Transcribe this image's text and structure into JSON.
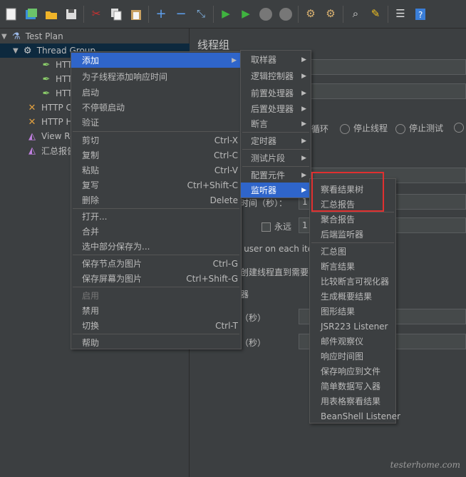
{
  "toolbar": {
    "icons": [
      "new-icon",
      "templates-icon",
      "open-icon",
      "save-icon",
      "cut-icon",
      "copy-icon",
      "paste-icon",
      "expand-icon",
      "collapse-icon",
      "toggle-icon",
      "start-icon",
      "start-no-pause-icon",
      "stop-icon",
      "shutdown-icon",
      "clear-icon",
      "clear-all-icon",
      "search-icon",
      "reset-search-icon",
      "function-helper-icon",
      "help-icon"
    ]
  },
  "tree": {
    "test_plan": "Test Plan",
    "thread_group": "Thread Group",
    "samplers": [
      "HTTP",
      "HTTP",
      "HTTP"
    ],
    "config1": "HTTP C",
    "config2": "HTTP H",
    "view_results": "View Re",
    "summary": "汇总报告"
  },
  "panel": {
    "title": "线程组",
    "loop_fragment": "续循环",
    "stop_thread": "停止线程",
    "stop_test": "停止测试",
    "ramp_fragment": "时间（秒）：",
    "ramp_value": "1",
    "forever": "永远",
    "loop_value": "1",
    "same_user": "e user on each iter",
    "delay_create": "创建线程直到需要",
    "scheduler": "器",
    "duration_unit": "（秒）",
    "delay_unit": "（秒）"
  },
  "context_menu": {
    "items": [
      {
        "label": "添加",
        "submenu": true
      },
      {
        "label": "为子线程添加响应时间"
      },
      {
        "label": "启动"
      },
      {
        "label": "不停顿启动"
      },
      {
        "label": "验证"
      },
      {
        "label": "剪切",
        "shortcut": "Ctrl-X"
      },
      {
        "label": "复制",
        "shortcut": "Ctrl-C"
      },
      {
        "label": "粘贴",
        "shortcut": "Ctrl-V"
      },
      {
        "label": "复写",
        "shortcut": "Ctrl+Shift-C"
      },
      {
        "label": "删除",
        "shortcut": "Delete"
      },
      {
        "label": "打开..."
      },
      {
        "label": "合并"
      },
      {
        "label": "选中部分保存为..."
      },
      {
        "label": "保存节点为图片",
        "shortcut": "Ctrl-G"
      },
      {
        "label": "保存屏幕为图片",
        "shortcut": "Ctrl+Shift-G"
      },
      {
        "label": "启用",
        "disabled": true
      },
      {
        "label": "禁用"
      },
      {
        "label": "切换",
        "shortcut": "Ctrl-T"
      },
      {
        "label": "帮助"
      }
    ]
  },
  "add_menu": {
    "items": [
      "取样器",
      "逻辑控制器",
      "前置处理器",
      "后置处理器",
      "断言",
      "定时器",
      "测试片段",
      "配置元件",
      "监听器"
    ]
  },
  "listener_menu": {
    "items": [
      "察看结果树",
      "汇总报告",
      "聚合报告",
      "后端监听器",
      "汇总图",
      "断言结果",
      "比较断言可视化器",
      "生成概要结果",
      "图形结果",
      "JSR223 Listener",
      "邮件观察仪",
      "响应时间图",
      "保存响应到文件",
      "简单数据写入器",
      "用表格察看结果",
      "BeanShell Listener"
    ]
  },
  "watermark": "testerhome.com",
  "colors": {
    "highlight": "#2f65ca",
    "annotation": "#e03030"
  }
}
